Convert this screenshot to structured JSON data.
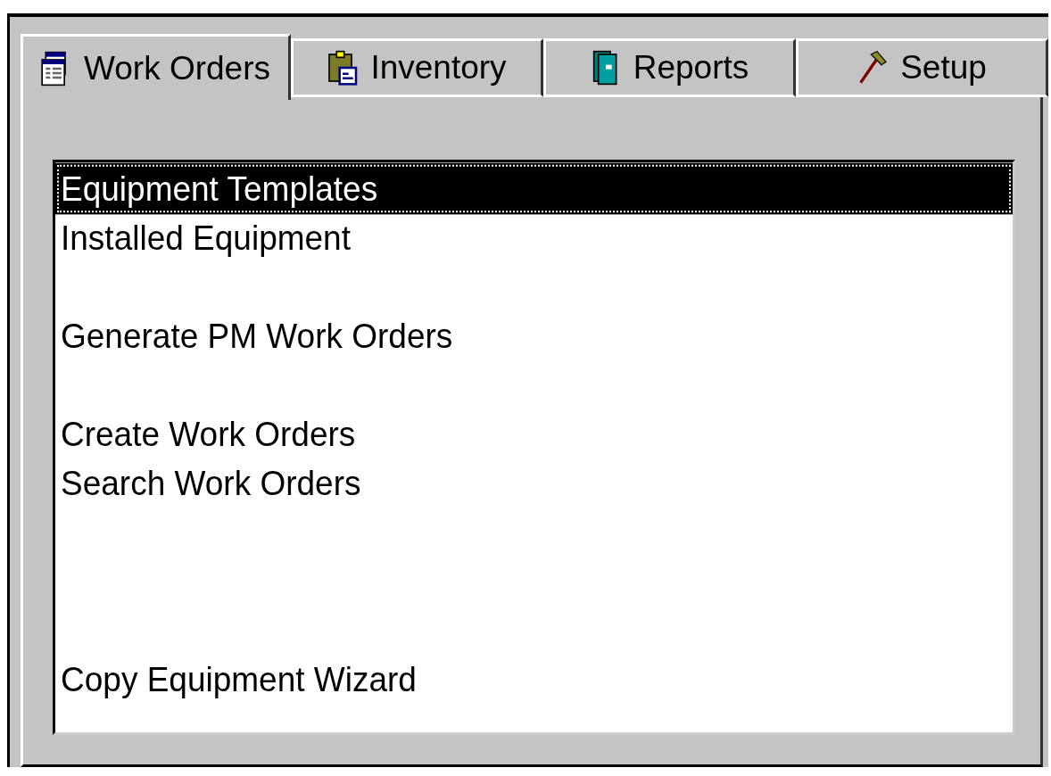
{
  "tabs": [
    {
      "label": "Work Orders",
      "kind": "forms",
      "selected": true
    },
    {
      "label": "Inventory",
      "kind": "clipboard",
      "selected": false
    },
    {
      "label": "Reports",
      "kind": "books",
      "selected": false
    },
    {
      "label": "Setup",
      "kind": "hammer",
      "selected": false
    }
  ],
  "list": [
    {
      "kind": "entry",
      "label": "Equipment Templates",
      "selected": true
    },
    {
      "kind": "entry",
      "label": "Installed Equipment",
      "selected": false
    },
    {
      "kind": "gap"
    },
    {
      "kind": "entry",
      "label": "Generate PM Work Orders",
      "selected": false
    },
    {
      "kind": "gap"
    },
    {
      "kind": "entry",
      "label": "Create Work Orders",
      "selected": false
    },
    {
      "kind": "entry",
      "label": "Search Work Orders",
      "selected": false
    },
    {
      "kind": "gap"
    },
    {
      "kind": "gap"
    },
    {
      "kind": "gap"
    },
    {
      "kind": "entry",
      "label": "Copy Equipment Wizard",
      "selected": false
    }
  ]
}
